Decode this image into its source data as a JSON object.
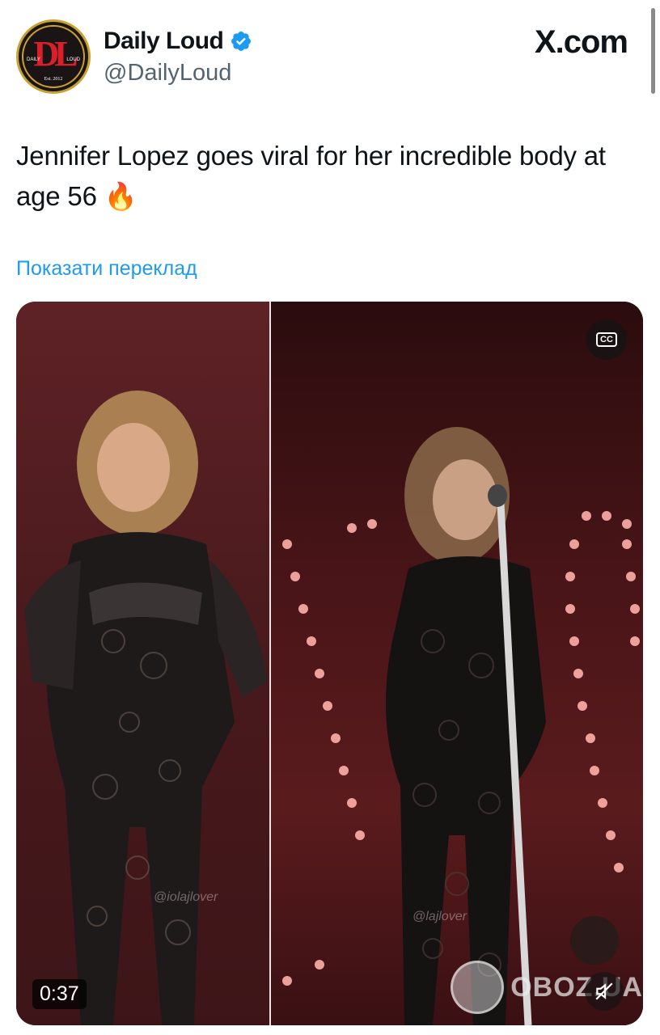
{
  "header": {
    "avatar": {
      "monogram": "DL",
      "left_text": "DAILY",
      "right_text": "LOUD",
      "est": "Est. 2012"
    },
    "name": "Daily Loud",
    "handle": "@DailyLoud",
    "site": "X.com",
    "verified_icon": "verified-badge-icon"
  },
  "tweet": {
    "text": "Jennifer Lopez goes viral for her incredible body at age 56 🔥",
    "translate_link": "Показати переклад"
  },
  "media": {
    "duration": "0:37",
    "cc_icon": "closed-captions-icon",
    "cc_label": "CC",
    "mute_icon": "muted-speaker-icon",
    "watermark_left": "@iolajlover",
    "watermark_right": "@lajlover",
    "site_watermark": "OBOZ.UA"
  },
  "colors": {
    "link": "#1d9bf0",
    "verified": "#1d9bf0",
    "handle": "#536471",
    "avatar_red": "#d8202a",
    "avatar_gold": "#c9a233"
  }
}
